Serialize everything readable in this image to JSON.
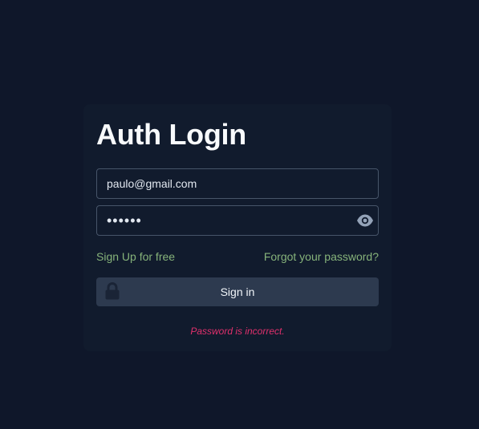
{
  "page": {
    "background_color": "#0f172a",
    "card_color": "#111b2d"
  },
  "login": {
    "title": "Auth Login",
    "email_value": "paulo@gmail.com",
    "password_value": "••••••",
    "password_toggle_icon": "eye-icon",
    "signup_label": "Sign Up for free",
    "forgot_label": "Forgot your password?",
    "signin_label": "Sign in",
    "signin_icon": "lock-icon",
    "error_message": "Password is incorrect.",
    "link_color": "#86b37a",
    "error_color": "#e1306c"
  }
}
